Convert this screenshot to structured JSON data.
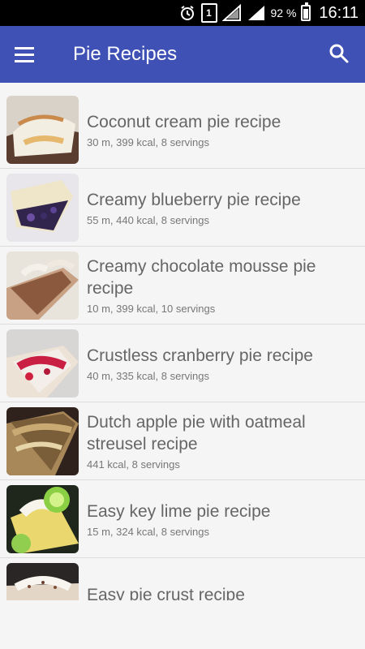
{
  "status_bar": {
    "battery_percent": "92 %",
    "time": "16:11",
    "sim_label": "1",
    "icons": [
      "alarm-icon",
      "sim-icon",
      "signal-icon",
      "signal-icon",
      "battery-icon"
    ]
  },
  "app_bar": {
    "title": "Pie Recipes",
    "menu_icon": "menu-icon",
    "search_icon": "search-icon",
    "color": "#3f51b5"
  },
  "recipes": [
    {
      "title": "Coconut cream pie recipe",
      "meta": "30 m, 399 kcal, 8 servings"
    },
    {
      "title": "Creamy blueberry pie recipe",
      "meta": "55 m, 440 kcal, 8 servings"
    },
    {
      "title": "Creamy chocolate mousse pie recipe",
      "meta": "10 m, 399 kcal, 10 servings"
    },
    {
      "title": "Crustless cranberry pie recipe",
      "meta": "40 m, 335 kcal, 8 servings"
    },
    {
      "title": "Dutch apple pie with oatmeal streusel recipe",
      "meta": "441 kcal, 8 servings"
    },
    {
      "title": "Easy key lime pie recipe",
      "meta": "15 m, 324 kcal, 8 servings"
    },
    {
      "title": "Easy pie crust recipe",
      "meta": ""
    }
  ]
}
